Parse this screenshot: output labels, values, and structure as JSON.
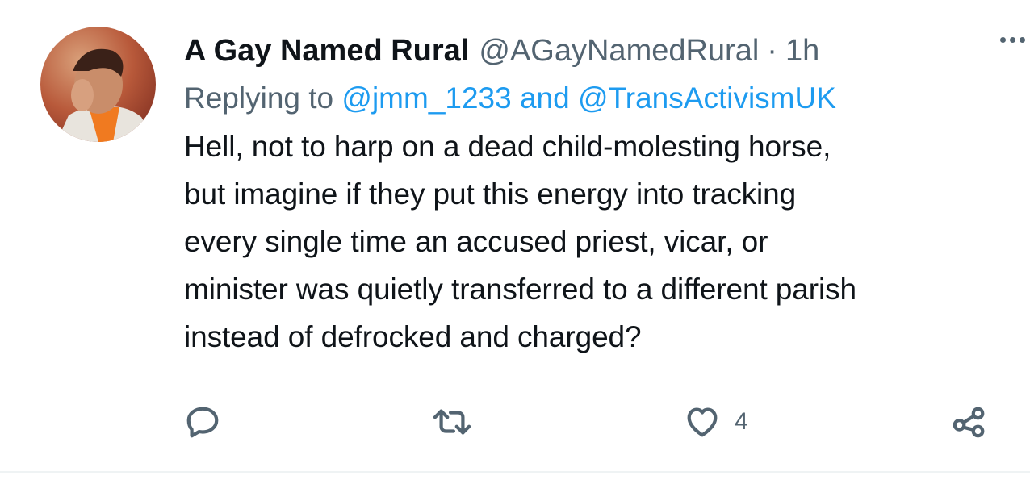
{
  "tweet": {
    "author": {
      "display_name": "A Gay Named Rural",
      "handle": "@AGayNamedRural"
    },
    "separator": "·",
    "time": "1h",
    "reply": {
      "prefix": "Replying to",
      "mentions": [
        "@jmm_1233",
        "@TransActivismUK"
      ],
      "conjunction": "and"
    },
    "text": "Hell, not to harp on a dead child-molesting horse,\nbut imagine if they put this energy into tracking\nevery single time an accused priest, vicar, or\nminister was quietly transferred to a different parish\ninstead of defrocked and charged?",
    "actions": {
      "reply_icon": "reply-icon",
      "retweet_icon": "retweet-icon",
      "like_icon": "heart-icon",
      "like_count": "4",
      "share_icon": "share-icon",
      "more_icon": "more-dots-icon"
    }
  },
  "colors": {
    "text": "#0f1419",
    "secondary": "#536471",
    "link": "#1d9bf0",
    "divider": "#eff3f4"
  }
}
